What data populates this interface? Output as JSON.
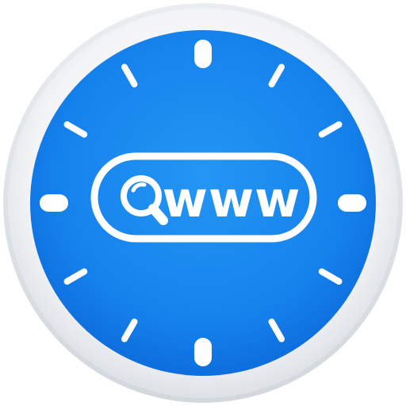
{
  "badge": {
    "text": "www"
  },
  "icons": {
    "search": "magnifier-icon",
    "bezel": "clock-bezel-icon",
    "ticks": "clock-tick-marks-icon"
  },
  "colors": {
    "rim_light": "#f4f5f7",
    "rim_shadow": "#d9dde3",
    "face_center": "#1f93f3",
    "face_edge": "#0a6fe0",
    "marks": "#ffffff"
  }
}
